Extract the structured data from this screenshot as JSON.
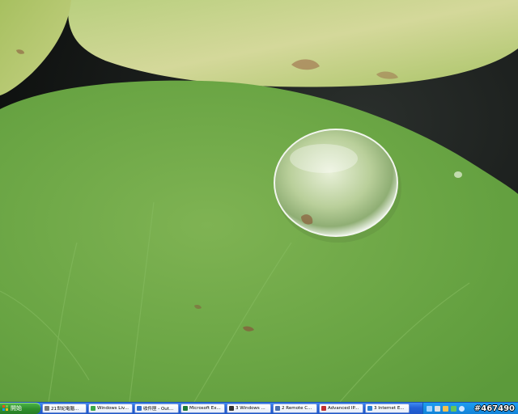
{
  "start_button": {
    "label": "開始"
  },
  "taskbar": {
    "buttons": [
      {
        "label": "21世紀電腦...",
        "icon": "document-icon",
        "color": "#7a7a7a"
      },
      {
        "label": "Windows Liv...",
        "icon": "messenger-icon",
        "color": "#3aa84a"
      },
      {
        "label": "收件匣 - Out...",
        "icon": "outlook-icon",
        "color": "#2f6fd0"
      },
      {
        "label": "Microsoft Ex...",
        "icon": "excel-icon",
        "color": "#1d7a3a"
      },
      {
        "label": "3 Windows ...",
        "icon": "folder-icon",
        "color": "#333333"
      },
      {
        "label": "2 Remote C...",
        "icon": "remote-icon",
        "color": "#4a6fb0"
      },
      {
        "label": "Advanced IP...",
        "icon": "ip-scanner-icon",
        "color": "#c03030"
      },
      {
        "label": "3 Internet E...",
        "icon": "ie-icon",
        "color": "#2a7fd4"
      }
    ]
  },
  "tray": {
    "icons": [
      "network-icon",
      "speaker-icon",
      "shield-icon",
      "update-icon",
      "clock-icon"
    ],
    "watermark": "#467490"
  }
}
